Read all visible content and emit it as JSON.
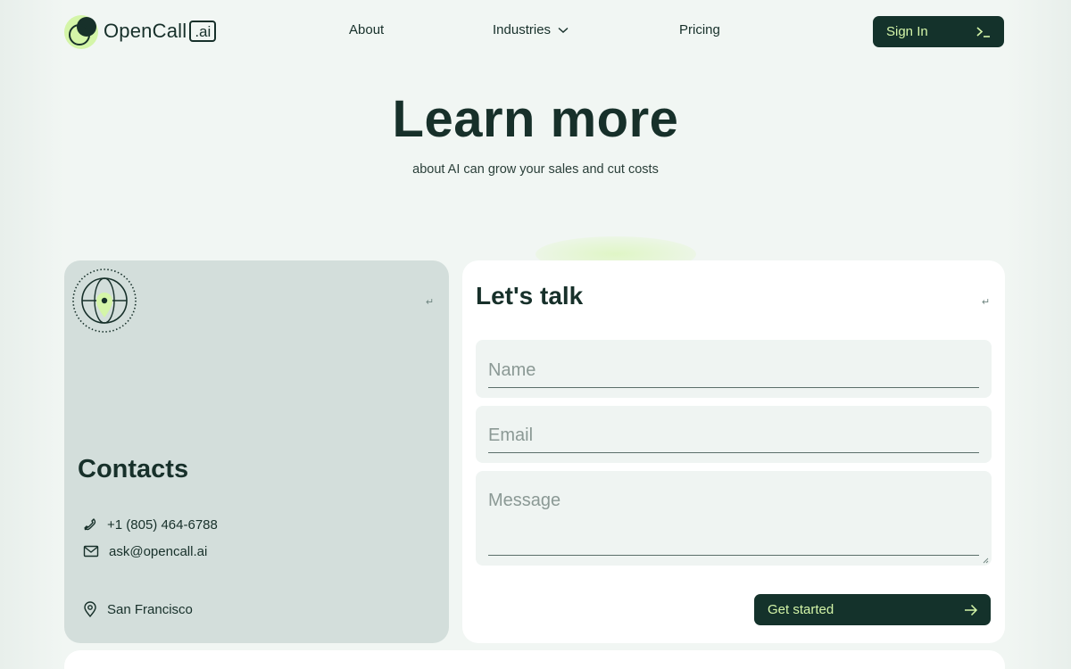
{
  "header": {
    "logo_text": "OpenCall",
    "logo_badge": ".ai",
    "nav": {
      "about": "About",
      "industries": "Industries",
      "pricing": "Pricing"
    },
    "signin_label": "Sign In",
    "signin_icon": "terminal-prompt-icon"
  },
  "hero": {
    "title": "Learn more",
    "subtitle": "about AI can grow your sales and cut costs"
  },
  "contacts": {
    "title": "Contacts",
    "phone": "+1 (805) 464-6788",
    "email": "ask@opencall.ai",
    "location": "San Francisco",
    "return_glyph": "↵"
  },
  "form": {
    "title": "Let's talk",
    "return_glyph": "↵",
    "name_placeholder": "Name",
    "email_placeholder": "Email",
    "message_placeholder": "Message",
    "submit_label": "Get started"
  },
  "colors": {
    "brand_dark": "#14322b",
    "accent_lime": "#d4f5a8",
    "contacts_bg": "#d3dedb",
    "page_bg": "#f1f6f3"
  }
}
